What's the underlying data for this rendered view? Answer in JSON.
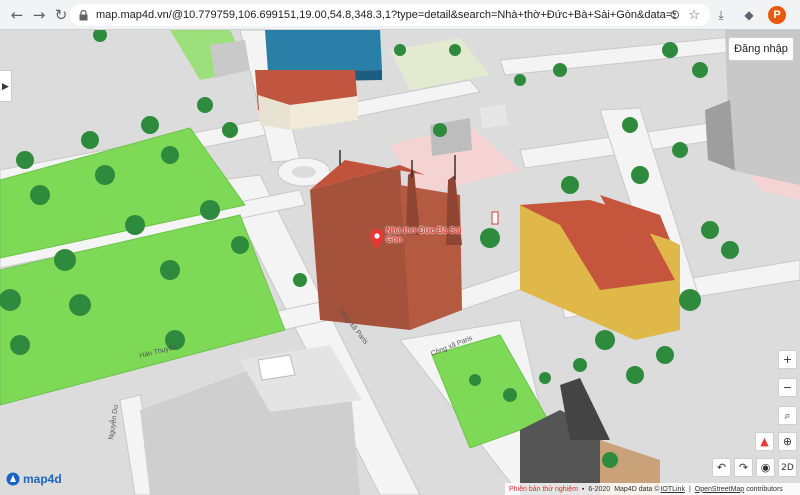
{
  "browser": {
    "url": "map.map4d.vn/@10.779759,106.699151,19.00,54.8,348.3,1?type=detail&search=Nhà+thờ+Đức+Bà+Sài+Gòn&data=5c9845e5814a9df9d67e5c33",
    "avatar_letter": "P",
    "icons": [
      "back-icon",
      "forward-icon",
      "reload-icon",
      "lock-icon",
      "location-icon",
      "star-icon",
      "download-icon",
      "extension-icon",
      "menu-icon"
    ]
  },
  "map": {
    "login_label": "Đăng nhập",
    "poi_name": "Nhà thờ Đức Bà Sài Gòn",
    "streets": [
      "Công xã Paris",
      "Công xã Paris",
      "Hàn Thuyên",
      "Nguyễn Du"
    ],
    "controls": {
      "zoom_in": "+",
      "zoom_out": "−",
      "compass": "▲",
      "view_mode": "2D"
    },
    "logo_text": "map4d",
    "footer": {
      "beta": "Phiên bản thử nghiệm",
      "year": "6-2020",
      "data_label": "Map4D data ©",
      "iot_link": "IOTLink",
      "osm_link": "OpenStreetMap",
      "contributors": "contributors"
    },
    "colors": {
      "park": "#7ed957",
      "road": "#f3f3f3",
      "ground": "#dcdcdc",
      "accent": "#e53935",
      "roof": "#c0533a",
      "brand": "#1c64c4"
    }
  }
}
